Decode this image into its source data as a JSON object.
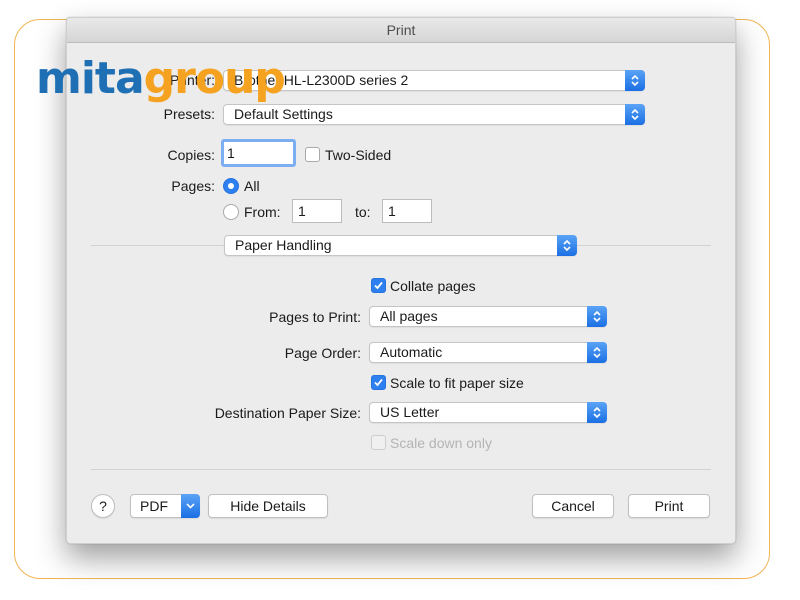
{
  "window": {
    "title": "Print"
  },
  "logo": {
    "part1": "mita",
    "part2": "group"
  },
  "printer": {
    "label": "Printer:",
    "value": "Brother HL-L2300D series 2"
  },
  "presets": {
    "label": "Presets:",
    "value": "Default Settings"
  },
  "copies": {
    "label": "Copies:",
    "value": "1",
    "two_sided_label": "Two-Sided",
    "two_sided_checked": false
  },
  "pages": {
    "label": "Pages:",
    "all_label": "All",
    "all_selected": true,
    "from_label": "From:",
    "from_value": "1",
    "to_label": "to:",
    "to_value": "1"
  },
  "section": {
    "value": "Paper Handling"
  },
  "paper_handling": {
    "collate_label": "Collate pages",
    "collate_checked": true,
    "pages_to_print_label": "Pages to Print:",
    "pages_to_print_value": "All pages",
    "page_order_label": "Page Order:",
    "page_order_value": "Automatic",
    "scale_fit_label": "Scale to fit paper size",
    "scale_fit_checked": true,
    "dest_size_label": "Destination Paper Size:",
    "dest_size_value": "US Letter",
    "scale_down_label": "Scale down only",
    "scale_down_checked": false,
    "scale_down_enabled": false
  },
  "footer": {
    "help_label": "?",
    "pdf_label": "PDF",
    "hide_details_label": "Hide Details",
    "cancel_label": "Cancel",
    "print_label": "Print"
  },
  "colors": {
    "accent": "#2e7ff0",
    "frame": "#f0b454",
    "logo_blue": "#1f6fb5",
    "logo_orange": "#f4a21f"
  },
  "icons": {
    "stepper": "up-down-chevron-icon",
    "check": "checkmark-icon",
    "pdf_menu": "chevron-down-icon"
  }
}
